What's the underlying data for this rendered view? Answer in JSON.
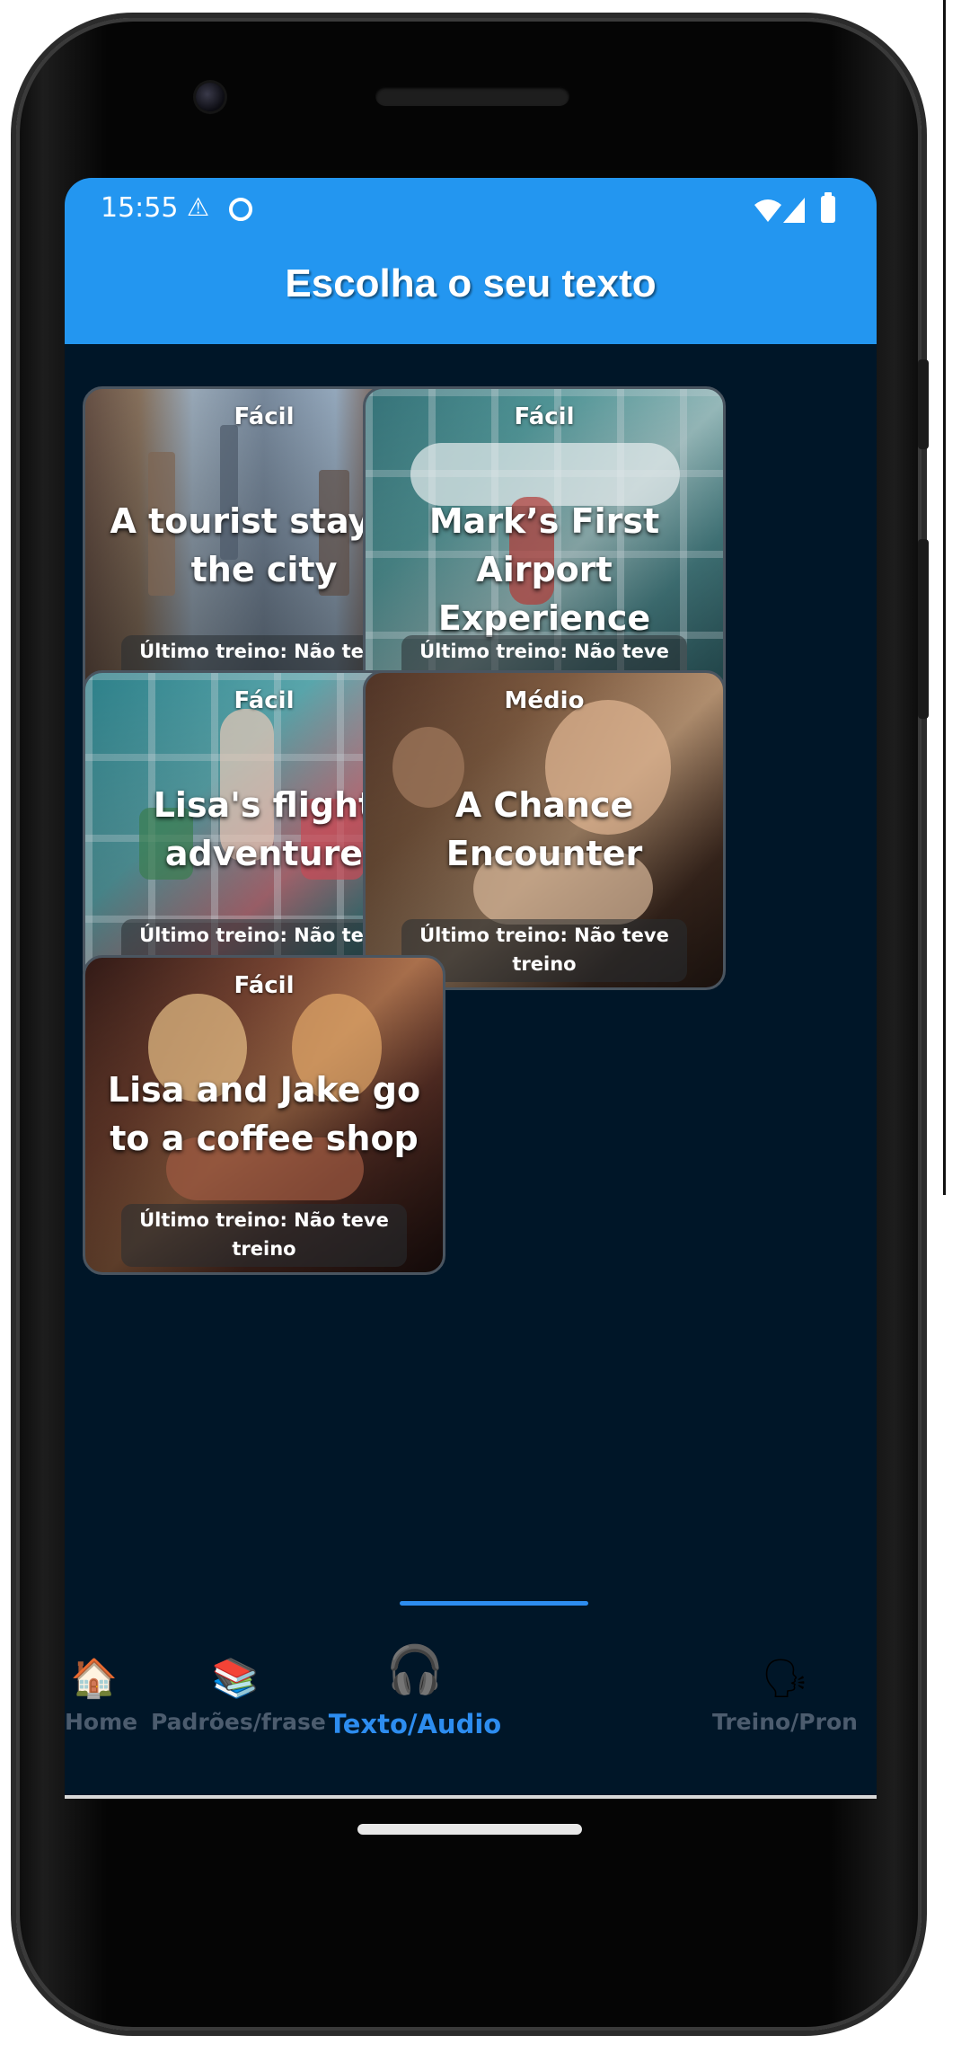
{
  "status_bar": {
    "time": "15:55",
    "icons": [
      "warning-icon",
      "app-notification-icon",
      "wifi-icon",
      "signal-icon",
      "battery-icon"
    ]
  },
  "app_bar": {
    "title": "Escolha o seu texto",
    "color": "#2396f0"
  },
  "cards": [
    {
      "level": "Fácil",
      "title": "A tourist stay in the city",
      "last_training": "Último treino: Não teve treino",
      "image": "city-street-illustration"
    },
    {
      "level": "Fácil",
      "title": "Mark’s First Airport Experience",
      "last_training": "Último treino: Não teve treino",
      "image": "airport-terminal-illustration"
    },
    {
      "level": "Fácil",
      "title": "Lisa's flight adventure",
      "last_training": "Último treino: Não teve treino",
      "image": "girl-at-airport-illustration"
    },
    {
      "level": "Médio",
      "title": "A Chance Encounter",
      "last_training": "Último treino: Não teve treino",
      "image": "boy-in-cafe-illustration"
    },
    {
      "level": "Fácil",
      "title": "Lisa and Jake go to a coffee shop",
      "last_training": "Último treino: Não teve treino",
      "image": "couple-in-coffee-shop-illustration"
    }
  ],
  "bottom_nav": {
    "items": [
      {
        "label": "Home",
        "icon": "house-icon"
      },
      {
        "label": "Padrões/frase",
        "icon": "books-icon"
      },
      {
        "label": "Texto/Audio",
        "icon": "listener-headphones-icon",
        "active": true
      },
      {
        "label": "Treino/Pron",
        "icon": "speaking-person-icon"
      }
    ],
    "active_color": "#2d8df0",
    "inactive_color": "#4c5c6e"
  },
  "colors": {
    "background": "#001628"
  }
}
